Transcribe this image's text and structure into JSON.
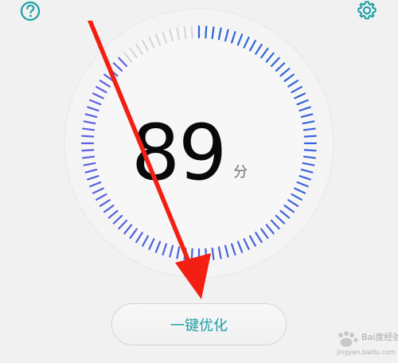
{
  "header": {
    "help_icon": "question-circle-icon",
    "settings_icon": "gear-icon"
  },
  "score": {
    "value": "89",
    "unit": "分",
    "level_percent": 89
  },
  "actions": {
    "optimize_label": "一键优化"
  },
  "watermark": {
    "brand_text": "Bai度经验",
    "url": "jingyan.baidu.com"
  },
  "colors": {
    "background": "#f1f1f1",
    "gauge_active": "#3a64d8",
    "gauge_inactive": "#d7d7d7",
    "accent": "#1d9fa4",
    "arrow": "#f21f12",
    "text_primary": "#090909"
  }
}
